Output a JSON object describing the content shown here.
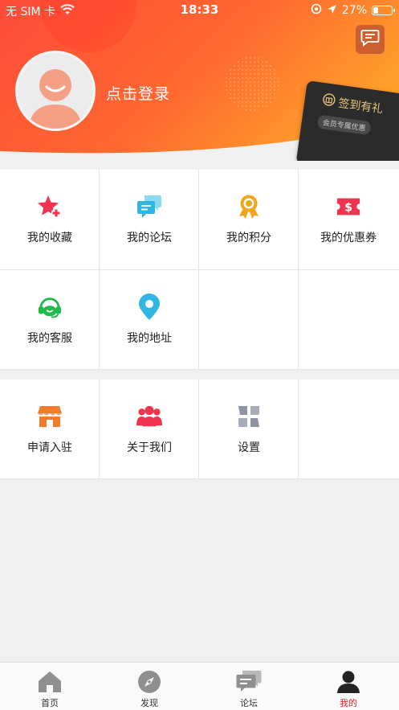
{
  "status_bar": {
    "carrier": "无 SIM 卡",
    "time": "18:33",
    "battery_percent": "27%",
    "battery_level": 0.27
  },
  "profile": {
    "login_text": "点击登录",
    "signin_title": "签到有礼",
    "signin_subtitle": "会员专属优惠"
  },
  "menu_section_1": [
    {
      "label": "我的收藏",
      "icon": "star-plus-icon",
      "color": "#f0334e"
    },
    {
      "label": "我的论坛",
      "icon": "chat-bubbles-icon",
      "color": "#2fb6e4"
    },
    {
      "label": "我的积分",
      "icon": "medal-icon",
      "color": "#f2a41b"
    },
    {
      "label": "我的优惠券",
      "icon": "coupon-icon",
      "color": "#f0334e"
    },
    {
      "label": "我的客服",
      "icon": "headset-icon",
      "color": "#22b84a"
    },
    {
      "label": "我的地址",
      "icon": "location-pin-icon",
      "color": "#2fb6e4"
    }
  ],
  "menu_section_2": [
    {
      "label": "申请入驻",
      "icon": "store-icon",
      "color": "#f47a2c"
    },
    {
      "label": "关于我们",
      "icon": "group-icon",
      "color": "#f0334e"
    },
    {
      "label": "设置",
      "icon": "settings-grid-icon",
      "color": "#8c93a3"
    }
  ],
  "tabbar": [
    {
      "label": "首页",
      "icon": "home-icon",
      "active": false
    },
    {
      "label": "发现",
      "icon": "compass-icon",
      "active": false
    },
    {
      "label": "论坛",
      "icon": "forum-icon",
      "active": false
    },
    {
      "label": "我的",
      "icon": "user-icon",
      "active": true
    }
  ],
  "colors": {
    "header_gradient_start": "#ff4f3a",
    "header_gradient_end": "#ff9a2a",
    "active_tab": "#d6262b",
    "signin_gold": "#e6c37a"
  }
}
